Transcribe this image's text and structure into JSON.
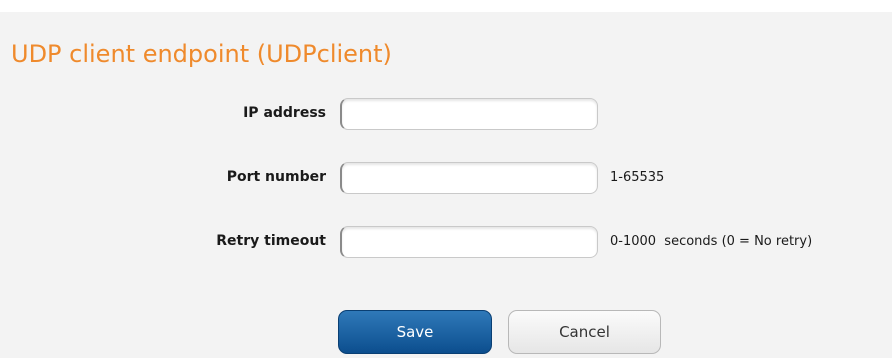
{
  "page": {
    "title": "UDP client endpoint (UDPclient)"
  },
  "form": {
    "ip_address": {
      "label": "IP address",
      "value": ""
    },
    "port_number": {
      "label": "Port number",
      "value": "",
      "hint": "1-65535"
    },
    "retry_timeout": {
      "label": "Retry timeout",
      "value": "",
      "hint": "0-1000  seconds (0 = No retry)"
    }
  },
  "actions": {
    "save_label": "Save",
    "cancel_label": "Cancel"
  },
  "colors": {
    "title": "#ef8a2c",
    "panel_background": "#f3f3f3",
    "save_button": "#1a5e9e"
  }
}
